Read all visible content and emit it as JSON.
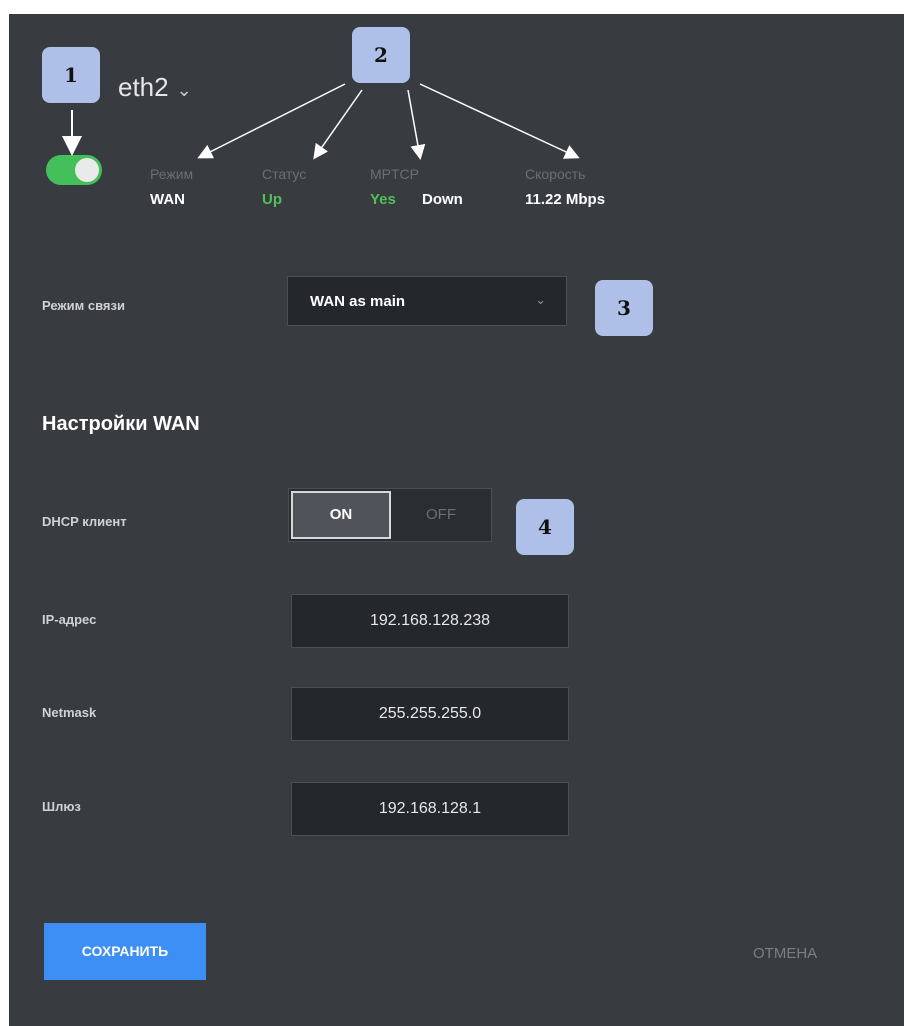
{
  "interface": {
    "name": "eth2",
    "enabled": true
  },
  "status_bar": {
    "mode": {
      "label": "Режим",
      "value": "WAN"
    },
    "status": {
      "label": "Статус",
      "value": "Up"
    },
    "mptcp": {
      "label": "MPTCP",
      "value_yes": "Yes",
      "value_down": "Down"
    },
    "speed": {
      "label": "Скорость",
      "value": "11.22 Mbps"
    }
  },
  "link_mode": {
    "label": "Режим связи",
    "selected": "WAN as main"
  },
  "wan_settings": {
    "title": "Настройки WAN",
    "dhcp": {
      "label": "DHCP клиент",
      "on_label": "ON",
      "off_label": "OFF",
      "value": "ON"
    },
    "ip": {
      "label": "IP-адрес",
      "value": "192.168.128.238"
    },
    "netmask": {
      "label": "Netmask",
      "value": "255.255.255.0"
    },
    "gateway": {
      "label": "Шлюз",
      "value": "192.168.128.1"
    }
  },
  "actions": {
    "save": "СОХРАНИТЬ",
    "cancel": "ОТМЕНА"
  },
  "callouts": [
    "1",
    "2",
    "3",
    "4"
  ],
  "colors": {
    "panel": "#383b40",
    "accent_green": "#43c05a",
    "save_blue": "#3d8ff5",
    "callout": "#aec0e8"
  }
}
